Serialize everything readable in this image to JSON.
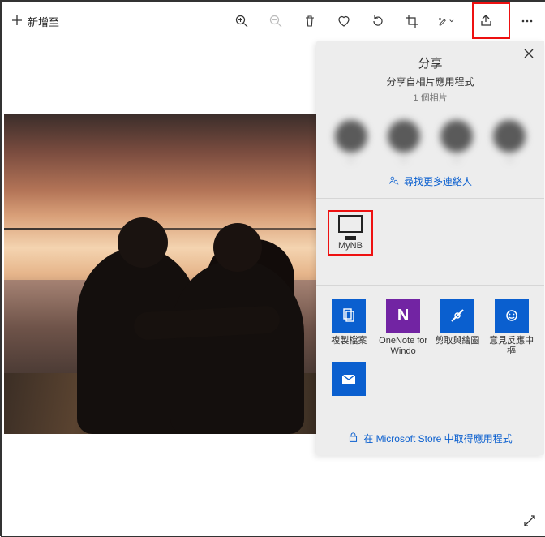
{
  "toolbar": {
    "add_label": "新增至"
  },
  "share_panel": {
    "title": "分享",
    "subtitle": "分享自相片應用程式",
    "count_text": "1 個相片",
    "find_more": "尋找更多連絡人",
    "contacts": [
      {
        "name": "—"
      },
      {
        "name": "—"
      },
      {
        "name": "—"
      },
      {
        "name": "—"
      }
    ],
    "device": {
      "label": "MyNB"
    },
    "apps": [
      {
        "label": "複製檔案",
        "tile_color": "blue",
        "glyph": "⧉"
      },
      {
        "label": "OneNote for Windo",
        "tile_color": "purple",
        "glyph": "N"
      },
      {
        "label": "剪取與繪圖",
        "tile_color": "blue",
        "glyph": "✎"
      },
      {
        "label": "意見反應中樞",
        "tile_color": "blue",
        "glyph": "☺"
      }
    ],
    "apps_row2": [
      {
        "label": "",
        "tile_color": "blue",
        "glyph": "✉"
      }
    ],
    "store_link": "在 Microsoft Store 中取得應用程式"
  }
}
